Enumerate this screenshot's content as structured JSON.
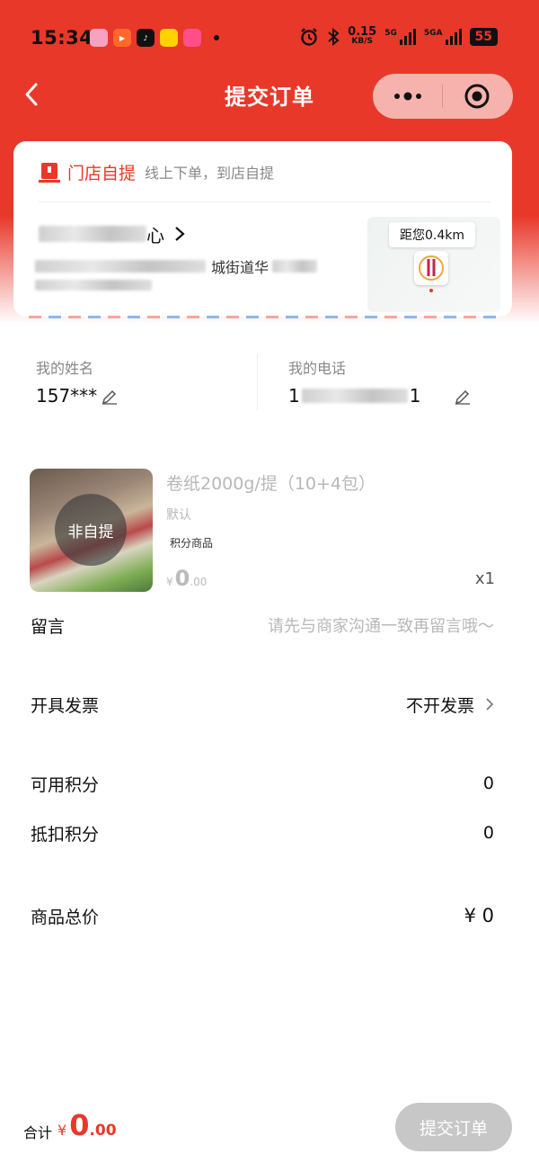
{
  "status_bar": {
    "time": "15:34",
    "net_speed_value": "0.15",
    "net_speed_unit": "KB/S",
    "signal1_label": "5G",
    "signal2_label": "5GA",
    "battery": "55",
    "app_icons": [
      "app-icon-1",
      "video-icon",
      "tiktok-icon",
      "meituan-icon",
      "shopping-icon"
    ]
  },
  "nav": {
    "title": "提交订单",
    "back_icon": "chevron-left-icon",
    "more_icon": "more-dots-icon",
    "close_icon": "target-icon"
  },
  "pickup": {
    "title": "门店自提",
    "subtitle": "线上下单，到店自提",
    "store_name_suffix": "心",
    "address_visible": "城街道华",
    "distance": "距您0.4km"
  },
  "contact": {
    "name_label": "我的姓名",
    "name_value": "157***",
    "phone_label": "我的电话",
    "phone_prefix": "1",
    "phone_suffix": "1"
  },
  "product": {
    "overlay": "非自提",
    "name": "卷纸2000g/提（10+4包）",
    "spec": "默认",
    "tag": "积分商品",
    "price_symbol": "¥",
    "price_int": "0",
    "price_dec": ".00",
    "quantity": "x1"
  },
  "message": {
    "label": "留言",
    "placeholder": "请先与商家沟通一致再留言哦～"
  },
  "invoice": {
    "label": "开具发票",
    "value": "不开发票"
  },
  "points_available": {
    "label": "可用积分",
    "value": "0"
  },
  "points_deduct": {
    "label": "抵扣积分",
    "value": "0"
  },
  "goods_total": {
    "label": "商品总价",
    "value": "¥ 0"
  },
  "footer": {
    "total_label": "合计",
    "total_symbol": "¥",
    "total_int": "0",
    "total_dec": ".00",
    "submit_label": "提交订单"
  },
  "colors": {
    "brand_red": "#e8382a",
    "disabled_gray": "#c7c7c7"
  }
}
